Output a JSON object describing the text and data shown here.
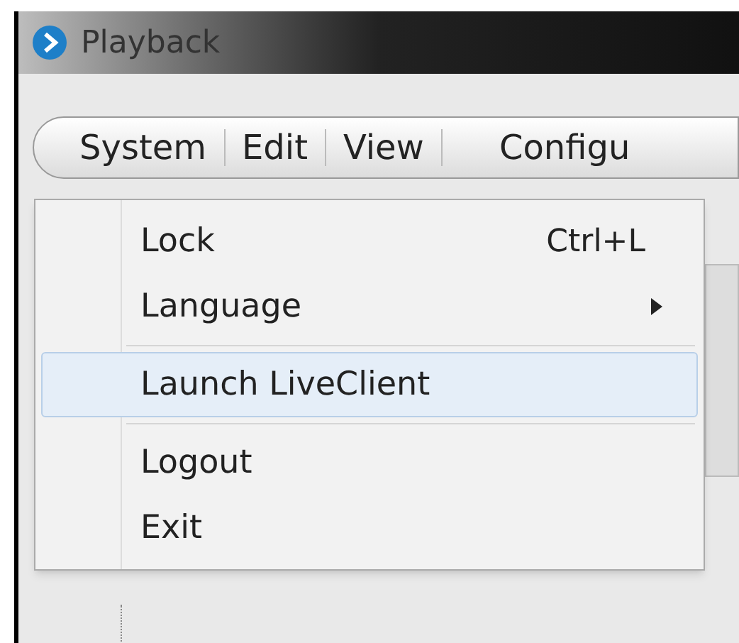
{
  "window": {
    "title": "Playback"
  },
  "menu_bar": [
    {
      "label": "System"
    },
    {
      "label": "Edit"
    },
    {
      "label": "View"
    },
    {
      "label": "Configu"
    }
  ],
  "dropdown": [
    {
      "kind": "item",
      "label": "Lock",
      "shortcut": "Ctrl+L",
      "submenu": false,
      "selected": false
    },
    {
      "kind": "item",
      "label": "Language",
      "submenu": true,
      "selected": false
    },
    {
      "kind": "separator"
    },
    {
      "kind": "item",
      "label": "Launch LiveClient",
      "submenu": false,
      "selected": true
    },
    {
      "kind": "separator"
    },
    {
      "kind": "item",
      "label": "Logout",
      "submenu": false,
      "selected": false
    },
    {
      "kind": "item",
      "label": "Exit",
      "submenu": false,
      "selected": false
    }
  ]
}
